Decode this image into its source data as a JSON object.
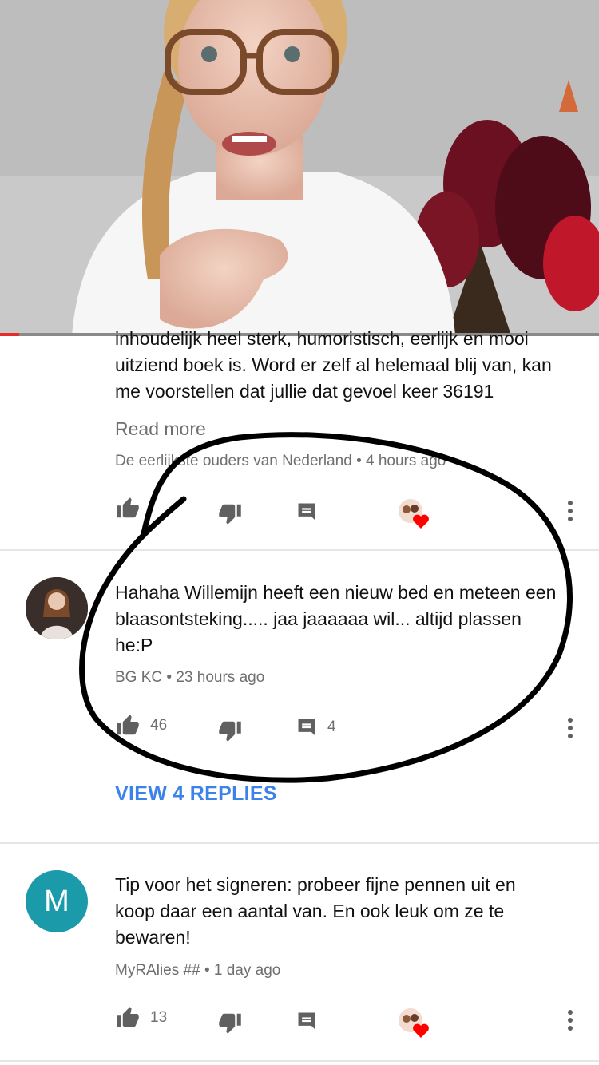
{
  "video": {
    "progress_fraction": 0.032
  },
  "comments": [
    {
      "text_lines": [
        "inhoudelijk heel sterk, humoristisch, eerlijk en mooi",
        "uitziend boek is. Word er zelf al helemaal blij van, kan",
        "me voorstellen dat jullie dat gevoel keer 36191"
      ],
      "read_more": "Read more",
      "author": "De eerlijkste ouders van Nederland",
      "time": "4 hours ago",
      "likes": "",
      "replies": ""
    },
    {
      "text_lines": [
        "Hahaha Willemijn heeft een nieuw bed en meteen een",
        "blaasontsteking..... jaa jaaaaaa wil... altijd plassen",
        "he:P"
      ],
      "author": "BG KC",
      "time": "23 hours ago",
      "likes": "46",
      "replies": "4",
      "view_replies": "VIEW 4 REPLIES"
    },
    {
      "avatar_letter": "M",
      "text_lines": [
        "Tip voor het signeren: probeer fijne pennen uit en",
        "koop daar een aantal van. En ook leuk om ze te",
        "bewaren!"
      ],
      "author": "MyRAlies ##",
      "time": "1 day ago",
      "likes": "13"
    }
  ],
  "colors": {
    "accent_blue": "#3c82e8",
    "progress_red": "#e52d27",
    "heart_red": "#ff0000",
    "avatar_teal": "#1b9aa9"
  },
  "icons": [
    "thumb-up-icon",
    "thumb-down-icon",
    "reply-icon",
    "creator-heart-icon",
    "more-vert-icon"
  ],
  "annotation": "hand-drawn ellipse circling second comment"
}
